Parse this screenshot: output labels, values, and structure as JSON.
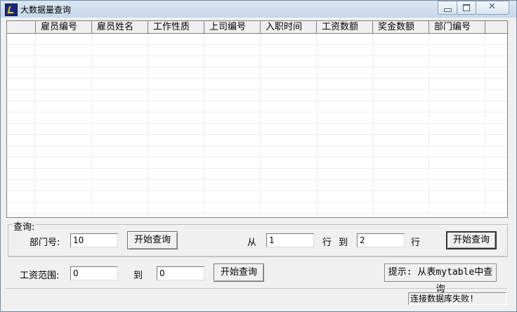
{
  "window": {
    "title": "大数据量查询",
    "close_glyph": "✕"
  },
  "grid": {
    "columns": [
      "",
      "雇员编号",
      "雇员姓名",
      "工作性质",
      "上司编号",
      "入职时间",
      "工资数额",
      "奖金数额",
      "部门编号"
    ]
  },
  "query": {
    "group_label": "查询:",
    "dept_label": "部门号:",
    "dept_value": "10",
    "dept_button": "开始查询",
    "from_label": "从",
    "from_value": "1",
    "row_label_1": "行",
    "to_label": "到",
    "to_value": "2",
    "row_label_2": "行",
    "range_button": "开始查询"
  },
  "salary": {
    "label": "工资范围:",
    "min_value": "0",
    "to_label": "到",
    "max_value": "0",
    "button": "开始查询"
  },
  "tip": "提示: 从表mytable中查询",
  "status": "连接数据库失败!"
}
